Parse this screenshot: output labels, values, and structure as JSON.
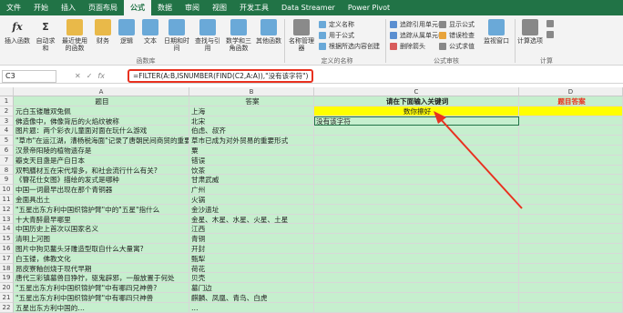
{
  "menu": {
    "tabs": [
      "文件",
      "开始",
      "插入",
      "页面布局",
      "公式",
      "数据",
      "审阅",
      "视图",
      "开发工具",
      "Data Streamer",
      "Power Pivot"
    ],
    "active_index": 4
  },
  "ribbon": {
    "insert_function": "插入函数",
    "autosum": "自动求和",
    "recent": "最近使用的函数",
    "financial": "财务",
    "logical": "逻辑",
    "text": "文本",
    "datetime": "日期和时间",
    "lookup": "查找与引用",
    "math": "数学和三角函数",
    "more": "其他函数",
    "group_library": "函数库",
    "name_manager": "名称管理器",
    "define_name": "定义名称",
    "use_in_formula": "用于公式",
    "create_from_selection": "根据所选内容创建",
    "group_names": "定义的名称",
    "trace_precedents": "追踪引用单元格",
    "trace_dependents": "追踪从属单元格",
    "remove_arrows": "删除箭头",
    "show_formulas": "显示公式",
    "error_checking": "错误检查",
    "evaluate_formula": "公式求值",
    "group_auditing": "公式审核",
    "watch_window": "监视窗口",
    "calc_options": "计算选项",
    "group_calc": "计算"
  },
  "formula_bar": {
    "name_box": "C3",
    "cancel": "✕",
    "enter": "✓",
    "fx": "fx",
    "formula": "=FILTER(A:B,ISNUMBER(FIND(C2,A:A)),\"没有该字符\")"
  },
  "columns": [
    "A",
    "B",
    "C",
    "D"
  ],
  "header_row": {
    "a": "题目",
    "b": "答案",
    "c": "请在下面输入关键词",
    "d": "题目答案"
  },
  "search_term": "数你擦好",
  "result_text": "没有该字符",
  "rows": [
    {
      "n": "1"
    },
    {
      "n": "2",
      "a": "元白玉镂雕双兔佩",
      "b": "上海"
    },
    {
      "n": "3",
      "a": "佛造像中，佛像背后的火焰纹被称",
      "b": "北宋"
    },
    {
      "n": "4",
      "a": "图片题：两个彩衣儿童面对面在玩什么游戏",
      "b": "伯虑、叔齐"
    },
    {
      "n": "5",
      "a": "\"草市\"在运江湖，漕杨税海面\"记录了唐朝民间商贸的重要形",
      "b": "草市已成为对外贸易的重要形式"
    },
    {
      "n": "6",
      "a": "汉景帝阳陵的植物遗存是",
      "b": "粟"
    },
    {
      "n": "7",
      "a": "瓣支天目盏是产自日本",
      "b": "错误"
    },
    {
      "n": "8",
      "a": "双鸭膳材五在宋代增多，和社会流行什么有关?",
      "b": "饮茶"
    },
    {
      "n": "9",
      "a": "《簪花仕女图》描绘的发式是哪种",
      "b": "甘肃武威"
    },
    {
      "n": "10",
      "a": "中国一词最早出现在那个青铜器",
      "b": "广州"
    },
    {
      "n": "11",
      "a": "金面具出土",
      "b": "火锅"
    },
    {
      "n": "12",
      "a": "\"五星出东方利中国织锦护臂\"中的\"五星\"指什么",
      "b": "金沙遗址"
    },
    {
      "n": "13",
      "a": "十大青醉最早哪里",
      "b": "金星、木星、水星、火星、土星"
    },
    {
      "n": "14",
      "a": "中国历史上首次以国家名义",
      "b": "江西"
    },
    {
      "n": "15",
      "a": "清明上河图",
      "b": "青铜"
    },
    {
      "n": "16",
      "a": "图片中狗见鳌头牙雕造型取自什么大量寓?",
      "b": "开封"
    },
    {
      "n": "17",
      "a": "白玉镂，佛教文化",
      "b": "甄犁"
    },
    {
      "n": "18",
      "a": "昂皮寮釉创烧于现代早期",
      "b": "荷花"
    },
    {
      "n": "19",
      "a": "唐代三彩镇墓兽目狰狞，驱鬼辟邪，一般放置于何处",
      "b": "贝壳"
    },
    {
      "n": "20",
      "a": "\"五星出东方利中国织锦护臂\"中有哪四兄神兽?",
      "b": "墓门边"
    },
    {
      "n": "21",
      "a": "\"五星出东方利中国织锦护臂\"中有哪四只神兽",
      "b": "麒麟、凤凰、青鸟、白虎"
    },
    {
      "n": "22",
      "a": "五星出东方利中国的…",
      "b": "…"
    }
  ]
}
